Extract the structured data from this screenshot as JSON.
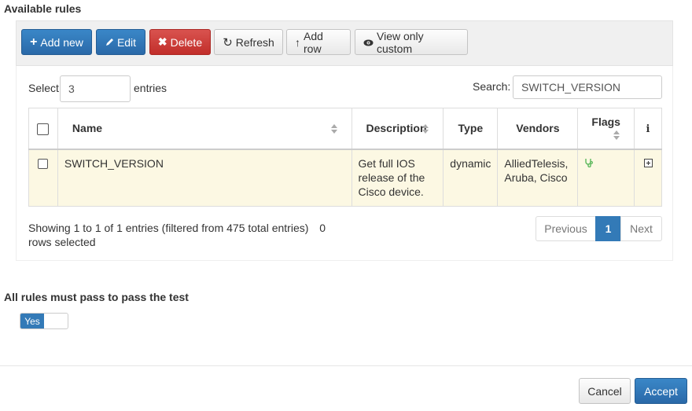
{
  "section_title": "Available rules",
  "toolbar": {
    "add_new": "Add new",
    "edit": "Edit",
    "delete": "Delete",
    "refresh": "Refresh",
    "add_row": "Add row",
    "view_only_custom": "View only custom"
  },
  "length": {
    "prefix": "Select",
    "value": "3",
    "suffix": "entries"
  },
  "search": {
    "label": "Search:",
    "value": "SWITCH_VERSION"
  },
  "table": {
    "headers": {
      "name": "Name",
      "description": "Description",
      "type": "Type",
      "vendors": "Vendors",
      "flags": "Flags",
      "info": "i"
    },
    "rows": [
      {
        "name": "SWITCH_VERSION",
        "description": "Get full IOS release of the Cisco device.",
        "type": "dynamic",
        "vendors": "AlliedTelesis, Aruba, Cisco",
        "flag_icon": "stethoscope-icon",
        "info_icon": "plus-square-icon"
      }
    ]
  },
  "info_text": "Showing 1 to 1 of 1 entries (filtered from 475 total entries)",
  "selected_text": "0 rows selected",
  "pagination": {
    "previous": "Previous",
    "current": "1",
    "next": "Next"
  },
  "pass_rule": {
    "label": "All rules must pass to pass the test",
    "toggle_value": "Yes"
  },
  "footer": {
    "cancel": "Cancel",
    "accept": "Accept"
  },
  "colors": {
    "primary": "#337ab7",
    "danger": "#d9534f",
    "row_highlight": "#fcf8e3",
    "flag_green": "#5cb85c"
  }
}
